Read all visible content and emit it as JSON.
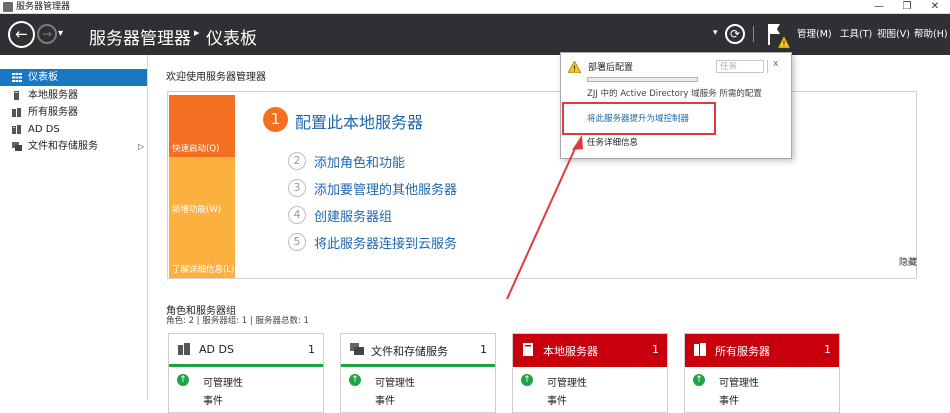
{
  "window": {
    "title": "服务器管理器",
    "minimize": "—",
    "restore": "❐",
    "close": "✕"
  },
  "header": {
    "back": "←",
    "forward": "→",
    "dropdown": "▾",
    "breadcrumb_root": "服务器管理器",
    "breadcrumb_sep": "▸",
    "breadcrumb_current": "仪表板",
    "refresh": "⟳",
    "menus": [
      "管理(M)",
      "工具(T)",
      "视图(V)",
      "帮助(H)"
    ]
  },
  "sidebar": {
    "items": [
      {
        "label": "仪表板",
        "icon": "dashboard-icon",
        "selected": true
      },
      {
        "label": "本地服务器",
        "icon": "server-icon"
      },
      {
        "label": "所有服务器",
        "icon": "servers-icon"
      },
      {
        "label": "AD DS",
        "icon": "ad-ds-icon"
      },
      {
        "label": "文件和存储服务",
        "icon": "storage-icon",
        "expand": "▷"
      }
    ]
  },
  "welcome": {
    "title": "欢迎使用服务器管理器",
    "tiles": [
      "快速启动(Q)",
      "新增功能(W)",
      "了解详细信息(L)"
    ],
    "step1_num": "1",
    "step1": "配置此本地服务器",
    "steps": [
      {
        "num": "2",
        "label": "添加角色和功能"
      },
      {
        "num": "3",
        "label": "添加要管理的其他服务器"
      },
      {
        "num": "4",
        "label": "创建服务器组"
      },
      {
        "num": "5",
        "label": "将此服务器连接到云服务"
      }
    ],
    "hide": "隐藏"
  },
  "roles": {
    "title": "角色和服务器组",
    "summary": "角色: 2 | 服务器组: 1 | 服务器总数: 1",
    "cards": [
      {
        "title": "AD DS",
        "count": "1",
        "status": "ok",
        "rows": [
          "可管理性",
          "事件"
        ]
      },
      {
        "title": "文件和存储服务",
        "count": "1",
        "status": "ok",
        "rows": [
          "可管理性",
          "事件"
        ]
      },
      {
        "title": "本地服务器",
        "count": "1",
        "status": "alert",
        "rows": [
          "可管理性",
          "事件"
        ]
      },
      {
        "title": "所有服务器",
        "count": "1",
        "status": "alert",
        "rows": [
          "可管理性",
          "事件"
        ]
      }
    ]
  },
  "popup": {
    "title": "部署后配置",
    "task_button": "任务",
    "close": "x",
    "description": "ZJJ 中的 Active Directory 域服务 所需的配置",
    "link": "将此服务器提升为域控制器",
    "details": "任务详细信息"
  },
  "colors": {
    "header_bg": "#2f3033",
    "nav_selected": "#1a78c2",
    "tile_orange": "#f36f21",
    "tile_light": "#fbb040",
    "link_blue": "#1f67ae",
    "alert_red": "#c8000e",
    "ok_green": "#1fa345",
    "annotation_red": "#e0393e"
  }
}
